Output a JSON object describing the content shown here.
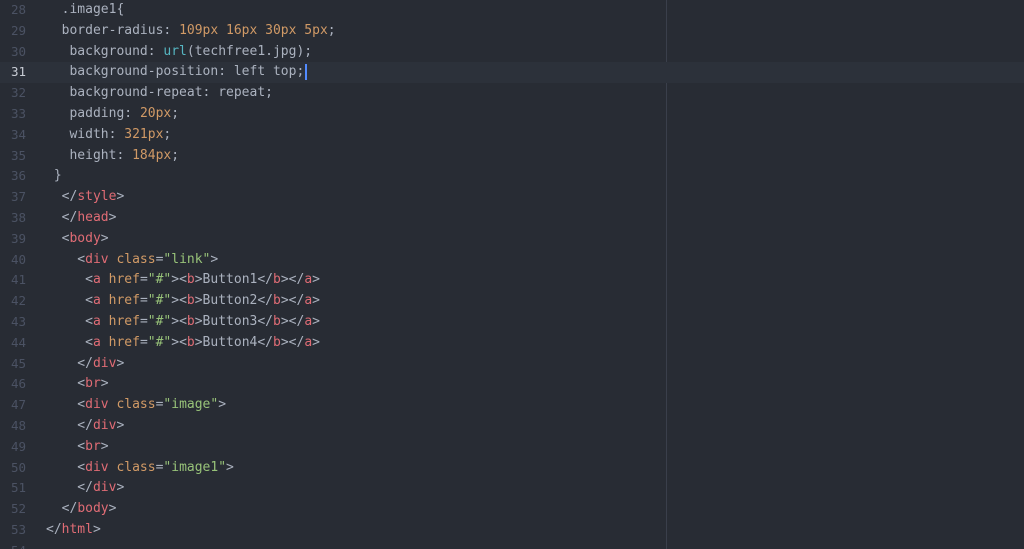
{
  "colors": {
    "background": "#282c34",
    "gutter_text": "#4b5263",
    "default": "#abb2bf",
    "tag": "#e06c75",
    "attribute": "#d19a66",
    "string": "#98c379",
    "number": "#d19a66",
    "function": "#56b6c2",
    "selector": "#d19a66",
    "cursor": "#528bff"
  },
  "editor": {
    "active_line": 31,
    "lines": [
      {
        "no": "28",
        "tokens": [
          {
            "t": "  .image1{",
            "c": "default"
          }
        ]
      },
      {
        "no": "29",
        "tokens": [
          {
            "t": "  border-radius",
            "c": "default"
          },
          {
            "t": ": ",
            "c": "default"
          },
          {
            "t": "109px 16px 30px 5px",
            "c": "number"
          },
          {
            "t": ";",
            "c": "default"
          }
        ]
      },
      {
        "no": "30",
        "tokens": [
          {
            "t": "   background",
            "c": "default"
          },
          {
            "t": ": ",
            "c": "default"
          },
          {
            "t": "url",
            "c": "function"
          },
          {
            "t": "(techfree1.jpg);",
            "c": "default"
          }
        ]
      },
      {
        "no": "31",
        "tokens": [
          {
            "t": "   background-position",
            "c": "default"
          },
          {
            "t": ": left top;",
            "c": "default"
          }
        ],
        "cursor": true
      },
      {
        "no": "32",
        "tokens": [
          {
            "t": "   background-repeat",
            "c": "default"
          },
          {
            "t": ": repeat;",
            "c": "default"
          }
        ]
      },
      {
        "no": "33",
        "tokens": [
          {
            "t": "   padding",
            "c": "default"
          },
          {
            "t": ": ",
            "c": "default"
          },
          {
            "t": "20px",
            "c": "number"
          },
          {
            "t": ";",
            "c": "default"
          }
        ]
      },
      {
        "no": "34",
        "tokens": [
          {
            "t": "   width",
            "c": "default"
          },
          {
            "t": ": ",
            "c": "default"
          },
          {
            "t": "321px",
            "c": "number"
          },
          {
            "t": ";",
            "c": "default"
          }
        ]
      },
      {
        "no": "35",
        "tokens": [
          {
            "t": "   height",
            "c": "default"
          },
          {
            "t": ": ",
            "c": "default"
          },
          {
            "t": "184px",
            "c": "number"
          },
          {
            "t": ";",
            "c": "default"
          }
        ]
      },
      {
        "no": "36",
        "tokens": [
          {
            "t": " }",
            "c": "default"
          }
        ]
      },
      {
        "no": "37",
        "tokens": [
          {
            "t": "  </",
            "c": "default"
          },
          {
            "t": "style",
            "c": "tag"
          },
          {
            "t": ">",
            "c": "default"
          }
        ]
      },
      {
        "no": "38",
        "tokens": [
          {
            "t": "  </",
            "c": "default"
          },
          {
            "t": "head",
            "c": "tag"
          },
          {
            "t": ">",
            "c": "default"
          }
        ]
      },
      {
        "no": "39",
        "tokens": [
          {
            "t": "  <",
            "c": "default"
          },
          {
            "t": "body",
            "c": "tag"
          },
          {
            "t": ">",
            "c": "default"
          }
        ]
      },
      {
        "no": "40",
        "tokens": [
          {
            "t": "    <",
            "c": "default"
          },
          {
            "t": "div",
            "c": "tag"
          },
          {
            "t": " ",
            "c": "default"
          },
          {
            "t": "class",
            "c": "attribute"
          },
          {
            "t": "=",
            "c": "default"
          },
          {
            "t": "\"link\"",
            "c": "string"
          },
          {
            "t": ">",
            "c": "default"
          }
        ]
      },
      {
        "no": "41",
        "tokens": [
          {
            "t": "     <",
            "c": "default"
          },
          {
            "t": "a",
            "c": "tag"
          },
          {
            "t": " ",
            "c": "default"
          },
          {
            "t": "href",
            "c": "attribute"
          },
          {
            "t": "=",
            "c": "default"
          },
          {
            "t": "\"#\"",
            "c": "string"
          },
          {
            "t": "><",
            "c": "default"
          },
          {
            "t": "b",
            "c": "tag"
          },
          {
            "t": ">Button1</",
            "c": "default"
          },
          {
            "t": "b",
            "c": "tag"
          },
          {
            "t": "></",
            "c": "default"
          },
          {
            "t": "a",
            "c": "tag"
          },
          {
            "t": ">",
            "c": "default"
          }
        ]
      },
      {
        "no": "42",
        "tokens": [
          {
            "t": "     <",
            "c": "default"
          },
          {
            "t": "a",
            "c": "tag"
          },
          {
            "t": " ",
            "c": "default"
          },
          {
            "t": "href",
            "c": "attribute"
          },
          {
            "t": "=",
            "c": "default"
          },
          {
            "t": "\"#\"",
            "c": "string"
          },
          {
            "t": "><",
            "c": "default"
          },
          {
            "t": "b",
            "c": "tag"
          },
          {
            "t": ">Button2</",
            "c": "default"
          },
          {
            "t": "b",
            "c": "tag"
          },
          {
            "t": "></",
            "c": "default"
          },
          {
            "t": "a",
            "c": "tag"
          },
          {
            "t": ">",
            "c": "default"
          }
        ]
      },
      {
        "no": "43",
        "tokens": [
          {
            "t": "     <",
            "c": "default"
          },
          {
            "t": "a",
            "c": "tag"
          },
          {
            "t": " ",
            "c": "default"
          },
          {
            "t": "href",
            "c": "attribute"
          },
          {
            "t": "=",
            "c": "default"
          },
          {
            "t": "\"#\"",
            "c": "string"
          },
          {
            "t": "><",
            "c": "default"
          },
          {
            "t": "b",
            "c": "tag"
          },
          {
            "t": ">Button3</",
            "c": "default"
          },
          {
            "t": "b",
            "c": "tag"
          },
          {
            "t": "></",
            "c": "default"
          },
          {
            "t": "a",
            "c": "tag"
          },
          {
            "t": ">",
            "c": "default"
          }
        ]
      },
      {
        "no": "44",
        "tokens": [
          {
            "t": "     <",
            "c": "default"
          },
          {
            "t": "a",
            "c": "tag"
          },
          {
            "t": " ",
            "c": "default"
          },
          {
            "t": "href",
            "c": "attribute"
          },
          {
            "t": "=",
            "c": "default"
          },
          {
            "t": "\"#\"",
            "c": "string"
          },
          {
            "t": "><",
            "c": "default"
          },
          {
            "t": "b",
            "c": "tag"
          },
          {
            "t": ">Button4</",
            "c": "default"
          },
          {
            "t": "b",
            "c": "tag"
          },
          {
            "t": "></",
            "c": "default"
          },
          {
            "t": "a",
            "c": "tag"
          },
          {
            "t": ">",
            "c": "default"
          }
        ]
      },
      {
        "no": "45",
        "tokens": [
          {
            "t": "    </",
            "c": "default"
          },
          {
            "t": "div",
            "c": "tag"
          },
          {
            "t": ">",
            "c": "default"
          }
        ]
      },
      {
        "no": "46",
        "tokens": [
          {
            "t": "    <",
            "c": "default"
          },
          {
            "t": "br",
            "c": "tag"
          },
          {
            "t": ">",
            "c": "default"
          }
        ]
      },
      {
        "no": "47",
        "tokens": [
          {
            "t": "    <",
            "c": "default"
          },
          {
            "t": "div",
            "c": "tag"
          },
          {
            "t": " ",
            "c": "default"
          },
          {
            "t": "class",
            "c": "attribute"
          },
          {
            "t": "=",
            "c": "default"
          },
          {
            "t": "\"image\"",
            "c": "string"
          },
          {
            "t": ">",
            "c": "default"
          }
        ]
      },
      {
        "no": "48",
        "tokens": [
          {
            "t": "    </",
            "c": "default"
          },
          {
            "t": "div",
            "c": "tag"
          },
          {
            "t": ">",
            "c": "default"
          }
        ]
      },
      {
        "no": "49",
        "tokens": [
          {
            "t": "    <",
            "c": "default"
          },
          {
            "t": "br",
            "c": "tag"
          },
          {
            "t": ">",
            "c": "default"
          }
        ]
      },
      {
        "no": "50",
        "tokens": [
          {
            "t": "    <",
            "c": "default"
          },
          {
            "t": "div",
            "c": "tag"
          },
          {
            "t": " ",
            "c": "default"
          },
          {
            "t": "class",
            "c": "attribute"
          },
          {
            "t": "=",
            "c": "default"
          },
          {
            "t": "\"image1\"",
            "c": "string"
          },
          {
            "t": ">",
            "c": "default"
          }
        ]
      },
      {
        "no": "51",
        "tokens": [
          {
            "t": "    </",
            "c": "default"
          },
          {
            "t": "div",
            "c": "tag"
          },
          {
            "t": ">",
            "c": "default"
          }
        ]
      },
      {
        "no": "52",
        "tokens": [
          {
            "t": "  </",
            "c": "default"
          },
          {
            "t": "body",
            "c": "tag"
          },
          {
            "t": ">",
            "c": "default"
          }
        ]
      },
      {
        "no": "53",
        "tokens": [
          {
            "t": "</",
            "c": "default"
          },
          {
            "t": "html",
            "c": "tag"
          },
          {
            "t": ">",
            "c": "default"
          }
        ]
      },
      {
        "no": "54",
        "tokens": []
      }
    ]
  }
}
